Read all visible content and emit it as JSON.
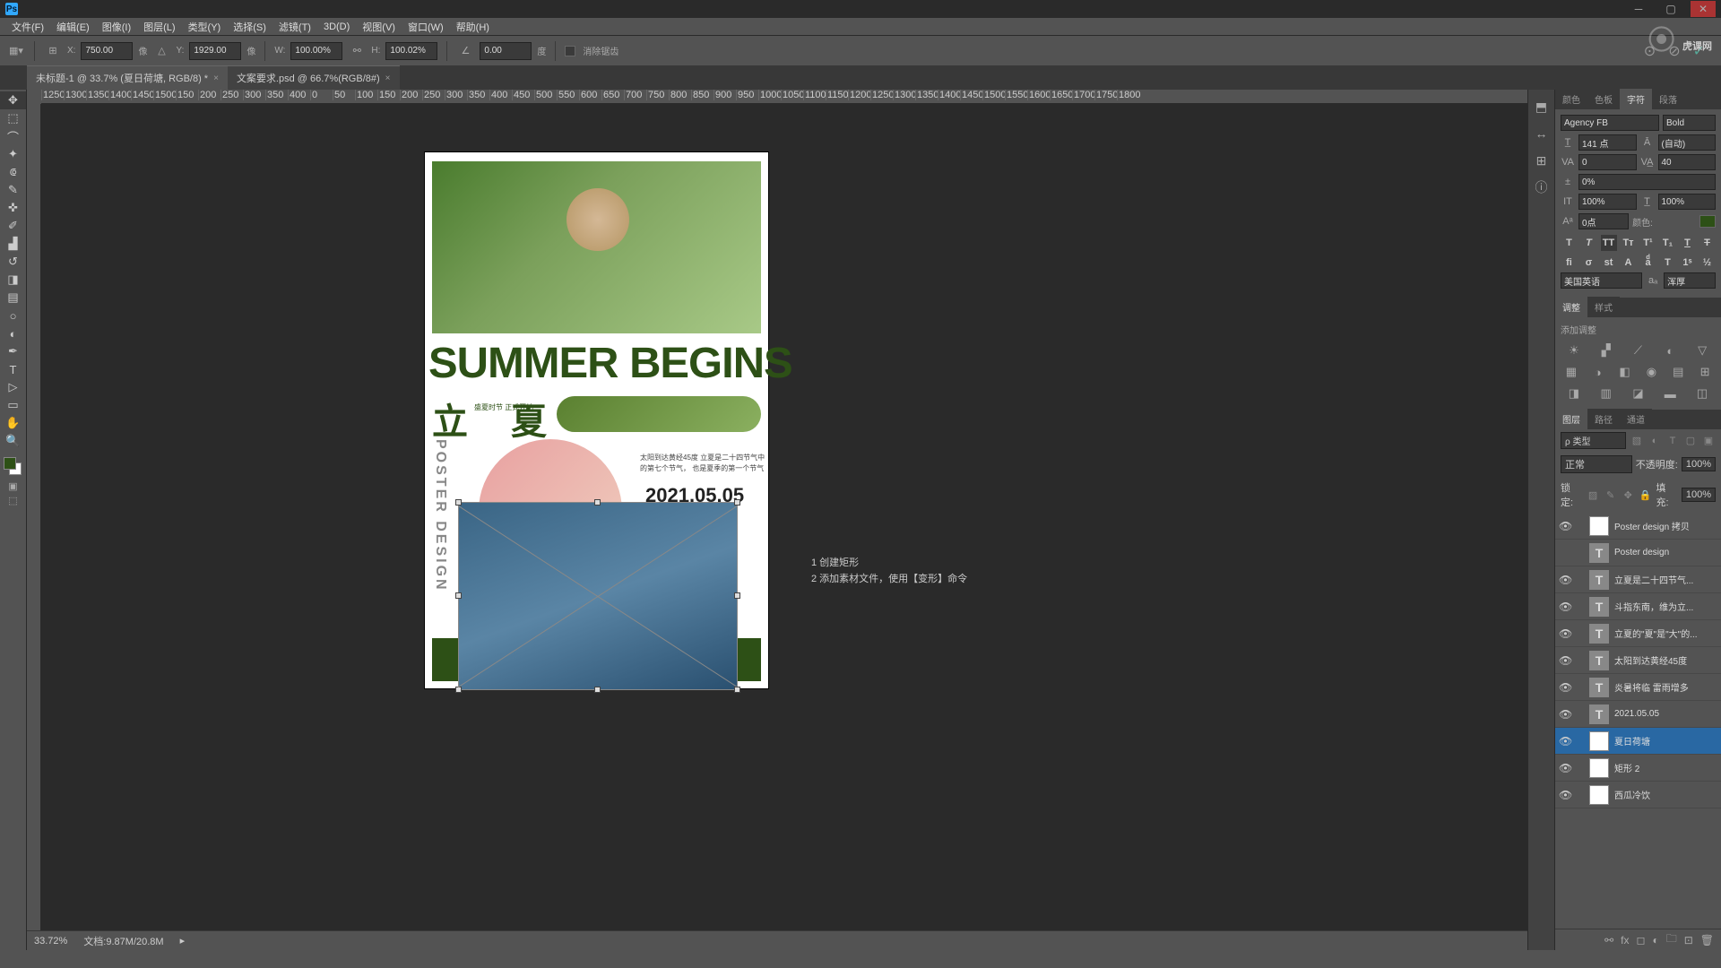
{
  "app": {
    "name": "Ps"
  },
  "menu": {
    "file": "文件(F)",
    "edit": "编辑(E)",
    "image": "图像(I)",
    "layer": "图层(L)",
    "type": "类型(Y)",
    "select": "选择(S)",
    "filter": "滤镜(T)",
    "threed": "3D(D)",
    "view": "视图(V)",
    "window": "窗口(W)",
    "help": "帮助(H)"
  },
  "options": {
    "x": "750.00",
    "y": "1929.00",
    "xu": "像",
    "yu": "像",
    "w": "100.00%",
    "h": "100.02%",
    "angle": "0.00",
    "angle_unit": "度",
    "interp": "消除锯齿",
    "x_lbl": "X:",
    "y_lbl": "Y:",
    "w_lbl": "W:",
    "h_lbl": "H:"
  },
  "tabs": {
    "t1": "未标题-1 @ 33.7% (夏日荷塘, RGB/8) *",
    "t2": "文案要求.psd @ 66.7%(RGB/8#)"
  },
  "status": {
    "zoom": "33.72%",
    "doc": "文档:9.87M/20.8M"
  },
  "anno": {
    "l1": "1 创建矩形",
    "l2": "2 添加素材文件，使用【变形】命令"
  },
  "poster": {
    "title": "SUMMER BEGINS",
    "li": "立",
    "xia": "夏",
    "small": "盛夏时节\n正式开始",
    "date": "2021.05.05",
    "info": "太阳到达黄经45度\n立夏是二十四节气中的第七个节气，\n也是夏季的第一个节气",
    "vert": "POSTER DESIGN"
  },
  "char": {
    "tab1": "颜色",
    "tab2": "色板",
    "tab3": "字符",
    "tab4": "段落",
    "font": "Agency FB",
    "style": "Bold",
    "size": "141 点",
    "leading": "(自动)",
    "va": "0",
    "tracking": "40",
    "scale": "0%",
    "vscale": "100%",
    "hscale": "100%",
    "baseline": "0点",
    "color_lbl": "颜色:",
    "lang": "美国英语",
    "aa": "浑厚"
  },
  "adj": {
    "tab1": "调整",
    "tab2": "样式",
    "hint": "添加调整"
  },
  "layers": {
    "tab1": "图层",
    "tab2": "路径",
    "tab3": "通道",
    "kind": "ρ 类型",
    "blend": "正常",
    "opacity_lbl": "不透明度:",
    "opacity": "100%",
    "lock_lbl": "锁定:",
    "fill_lbl": "填充:",
    "fill": "100%",
    "items": [
      {
        "name": "Poster design 拷贝",
        "t": false,
        "vis": true
      },
      {
        "name": "Poster design",
        "t": true,
        "vis": false
      },
      {
        "name": "立夏是二十四节气...",
        "t": true,
        "vis": true
      },
      {
        "name": "斗指东南，维为立...",
        "t": true,
        "vis": true
      },
      {
        "name": "立夏的\"夏\"是\"大\"的...",
        "t": true,
        "vis": true
      },
      {
        "name": "太阳到达黄经45度",
        "t": true,
        "vis": true
      },
      {
        "name": "炎暑将临 雷雨增多",
        "t": true,
        "vis": true
      },
      {
        "name": "2021.05.05",
        "t": true,
        "vis": true
      },
      {
        "name": "夏日荷塘",
        "t": false,
        "vis": true,
        "sel": true
      },
      {
        "name": "矩形 2",
        "t": false,
        "vis": true
      },
      {
        "name": "西瓜冷饮",
        "t": false,
        "vis": true
      }
    ]
  },
  "watermark": "虎课网"
}
